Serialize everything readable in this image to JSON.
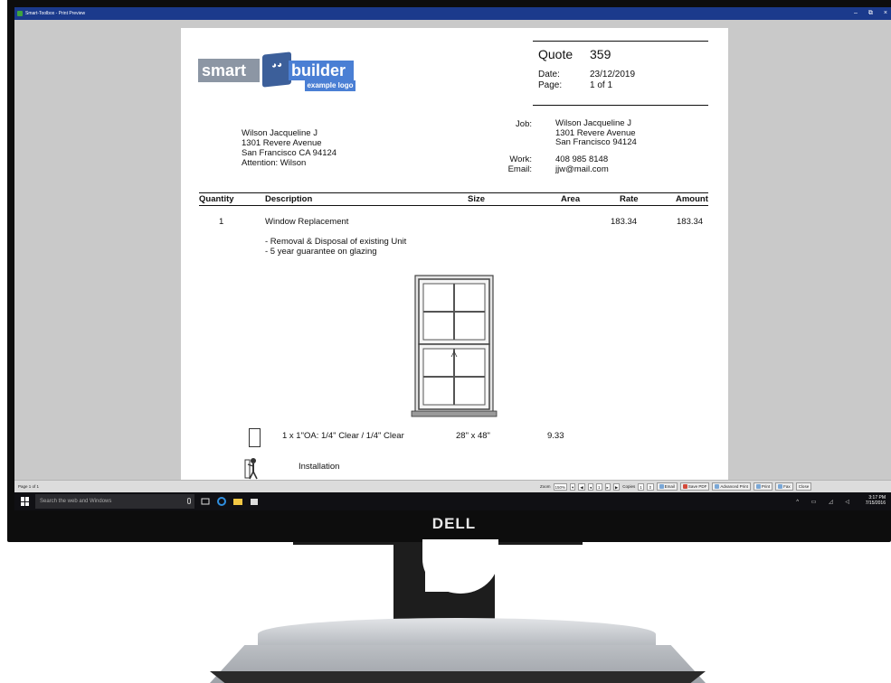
{
  "window": {
    "title": "Smart-Toolbox - Print Preview",
    "controls": [
      "–",
      "⧉",
      "×"
    ]
  },
  "document": {
    "logo": {
      "part1": "smart",
      "part2": "builder",
      "tagline": "example logo"
    },
    "quote": {
      "label": "Quote",
      "number": "359",
      "date_label": "Date:",
      "date": "23/12/2019",
      "page_label": "Page:",
      "page": "1 of 1"
    },
    "customer": {
      "name": "Wilson Jacqueline J",
      "street": "1301 Revere Avenue",
      "city": "San Francisco  CA  94124",
      "attention": "Attention:  Wilson"
    },
    "labels": {
      "job": "Job:",
      "work": "Work:",
      "email": "Email:"
    },
    "job_address": {
      "name": "Wilson Jacqueline J",
      "street": "1301 Revere Avenue",
      "city": "San Francisco  94124"
    },
    "contact": {
      "work": "408 985 8148",
      "email": "jjw@mail.com"
    },
    "table": {
      "headers": {
        "quantity": "Quantity",
        "description": "Description",
        "size": "Size",
        "area": "Area",
        "rate": "Rate",
        "amount": "Amount"
      },
      "row1": {
        "qty": "1",
        "desc": "Window Replacement",
        "rate": "183.34",
        "amount": "183.34"
      },
      "notes": [
        "- Removal & Disposal of existing Unit",
        "- 5 year guarantee on glazing"
      ],
      "row2": {
        "desc": "1 x 1\"OA: 1/4\" Clear / 1/4\" Clear",
        "size": "28\" x 48\"",
        "area": "9.33"
      },
      "row3": {
        "desc": "Installation"
      }
    }
  },
  "statusbar": {
    "page_info": "Page 1 of 1",
    "zoom_label": "Zoom",
    "zoom_value": "150%",
    "page_value": "1",
    "copies_label": "Copies",
    "copies_value": "1",
    "email": "Email",
    "save_pdf": "Save PDF",
    "advanced_print": "Advanced Print",
    "print": "Print",
    "fax": "Fax",
    "close": "Close"
  },
  "taskbar": {
    "search_placeholder": "Search the web and Windows",
    "time": "3:17 PM",
    "date": "7/15/2016"
  },
  "monitor": {
    "brand": "DELL"
  }
}
